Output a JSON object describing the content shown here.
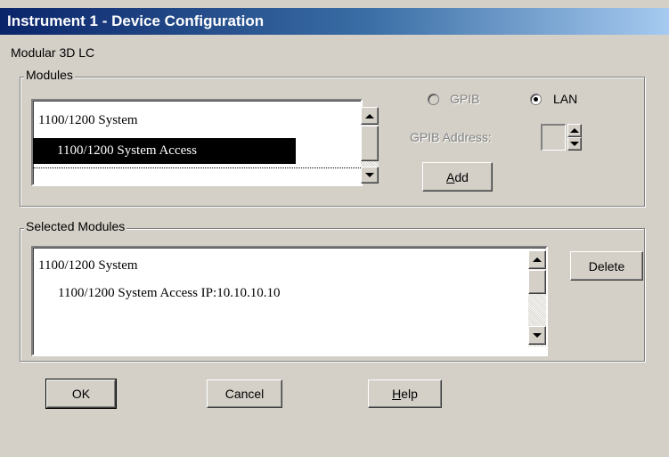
{
  "window": {
    "title": "Instrument 1 - Device Configuration"
  },
  "instrument_label": "Modular 3D LC",
  "modules": {
    "group_label": "Modules",
    "items": [
      "1100/1200 System",
      "1100/1200 System Access"
    ],
    "selected_index": 1
  },
  "connection": {
    "gpib_label": "GPIB",
    "lan_label": "LAN",
    "selected": "LAN",
    "gpib_address_label": "GPIB Address:",
    "gpib_address_value": "",
    "add_button": {
      "prefix": "",
      "mnemonic": "A",
      "suffix": "dd"
    }
  },
  "selected_modules": {
    "group_label": "Selected Modules",
    "items": [
      "1100/1200 System",
      "1100/1200 System Access IP:10.10.10.10"
    ],
    "delete_button": "Delete"
  },
  "buttons": {
    "ok": "OK",
    "cancel": "Cancel",
    "help": {
      "prefix": "",
      "mnemonic": "H",
      "suffix": "elp"
    }
  }
}
